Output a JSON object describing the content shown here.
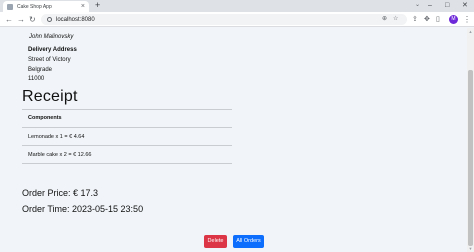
{
  "browser": {
    "tab_title": "Cake Shop App",
    "tab_close": "×",
    "new_tab": "+",
    "tab_list_icon": "⌄",
    "window_controls": [
      "–",
      "□",
      "✕"
    ],
    "back": "←",
    "forward": "→",
    "reload": "↻",
    "url": "localhost:8080",
    "zoom_icon": "⊕",
    "share_icon": "⇪",
    "bookmark_icon": "☆",
    "extensions_icon": "✥",
    "reading_list_icon": "≡",
    "sidebar_icon": "▯",
    "profile_initial": "M",
    "menu_icon": "⋮"
  },
  "customer": {
    "name": "John   Malinovsky"
  },
  "delivery": {
    "label": "Delivery Address",
    "street": "Street of Victory",
    "city": "Belgrade",
    "zip": "11000"
  },
  "receipt": {
    "title": "Receipt",
    "components_header": "Components",
    "items": [
      {
        "text": "Lemonade   x   1    =   € 4.64"
      },
      {
        "text": "Marble cake   x   2    =   € 12.66"
      }
    ],
    "order_price": "Order Price:   € 17.3",
    "order_time": "Order Time:   2023-05-15 23:50"
  },
  "actions": {
    "delete": "Delete",
    "all_orders": "All Orders"
  },
  "scrollbar": {
    "up": "▲",
    "down": "▼"
  }
}
